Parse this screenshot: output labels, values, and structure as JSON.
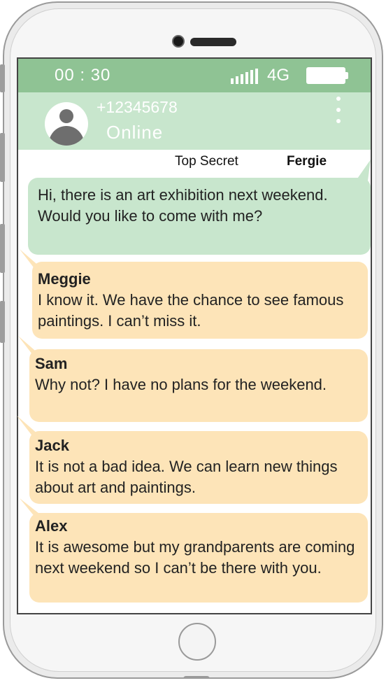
{
  "status_bar": {
    "time": "00 : 30",
    "network": "4G"
  },
  "contact": {
    "number": "+12345678",
    "status": "Online"
  },
  "chat": {
    "title": "Top Secret",
    "user": "Fergie"
  },
  "messages": [
    {
      "sender": "",
      "text": "Hi, there is an art exhibition next weekend. Would you like to come with me?"
    },
    {
      "sender": "Meggie",
      "text": "I know it. We have the chance to see famous paintings. I can’t miss it."
    },
    {
      "sender": "Sam",
      "text": "Why not? I have no plans for the weekend."
    },
    {
      "sender": "Jack",
      "text": "It is not a bad idea. We can learn new things about art and paintings."
    },
    {
      "sender": "Alex",
      "text": "It is awesome but my grandparents are coming next weekend so I can’t be there with you."
    }
  ],
  "colors": {
    "status_green": "#8fc394",
    "header_green": "#c8e6cd",
    "bubble_orange": "#fde4b8"
  }
}
